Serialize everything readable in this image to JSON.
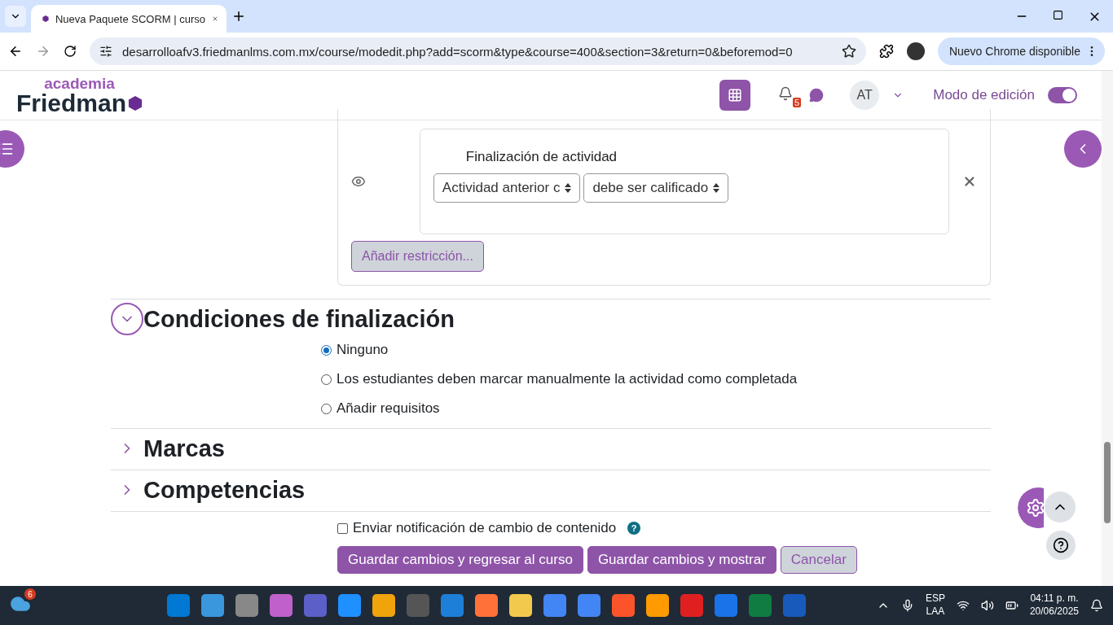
{
  "browser": {
    "tabs": [
      {
        "title": "Nueva Paquete SCORM | curso",
        "selected": true
      }
    ],
    "url": "desarrolloafv3.friedmanlms.com.mx/course/modedit.php?add=scorm&type&course=400&section=3&return=0&beforemod=0",
    "update_button": "Nuevo Chrome disponible"
  },
  "header": {
    "logo_top": "academia",
    "logo_main": "Friedman",
    "notifications_count": "5",
    "avatar": "AT",
    "edit_mode": {
      "label": "Modo de edición",
      "on": true
    }
  },
  "restriction": {
    "title": "Finalización de actividad",
    "selects": [
      "Actividad anterior c",
      "debe ser calificado"
    ],
    "add_button": "Añadir restricción..."
  },
  "sections": [
    {
      "title": "Condiciones de finalización",
      "expanded": true,
      "options": [
        {
          "label": "Ninguno",
          "selected": true
        },
        {
          "label": "Los estudiantes deben marcar manualmente la actividad como completada",
          "selected": false
        },
        {
          "label": "Añadir requisitos",
          "selected": false
        }
      ]
    },
    {
      "title": "Marcas",
      "expanded": false
    },
    {
      "title": "Competencias",
      "expanded": false
    }
  ],
  "notify": {
    "label": "Enviar notificación de cambio de contenido",
    "checked": false,
    "help": "?"
  },
  "buttons": [
    {
      "label": "Guardar cambios y regresar al curso",
      "kind": "primary"
    },
    {
      "label": "Guardar cambios y mostrar",
      "kind": "primary"
    },
    {
      "label": "Cancelar",
      "kind": "secondary"
    }
  ],
  "taskbar": {
    "weather_badge": "6",
    "language": "ESP",
    "layout": "LAA",
    "time": "04:11 p. m.",
    "date": "20/06/2025"
  }
}
